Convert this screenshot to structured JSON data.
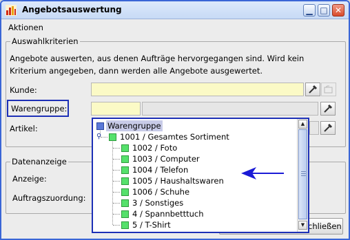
{
  "window": {
    "title": "Angebotsauswertung",
    "controls": [
      "minimize",
      "maximize",
      "close"
    ]
  },
  "menubar": {
    "items": [
      "Aktionen"
    ]
  },
  "selection": {
    "legend": "Auswahlkriterien",
    "description": "Angebote auswerten, aus denen Aufträge hervorgegangen sind. Wird kein Kriterium angegeben, dann werden alle Angebote ausgewertet.",
    "kunde_label": "Kunde:",
    "warengruppe_label": "Warengruppe:",
    "artikel_label": "Artikel:"
  },
  "data_display": {
    "legend": "Datenanzeige",
    "anzeige_label": "Anzeige:",
    "auftragszuordnung_label": "Auftragszuordung:"
  },
  "buttons": {
    "close_partial": "chließen"
  },
  "tree": {
    "root": "Warengruppe",
    "parent": "1001 / Gesamtes Sortiment",
    "children": [
      "1002 / Foto",
      "1003 / Computer",
      "1004 / Telefon",
      "1005 / Haushaltswaren",
      "1006 / Schuhe",
      "3 / Sonstiges",
      "4 / Spannbetttuch",
      "5 / T-Shirt"
    ]
  },
  "colors": {
    "title_gradient_top": "#dde9fb",
    "highlight_border": "#1c2fb6",
    "node_green": "#55e16b",
    "node_blue": "#5b79d8",
    "field_yellow": "#fbfac6",
    "annotation_arrow": "#1a1ad6"
  },
  "icons": {
    "app": "bar-chart-icon",
    "lookup": "pipette-icon",
    "disabled_action": "folder-refresh-icon"
  }
}
